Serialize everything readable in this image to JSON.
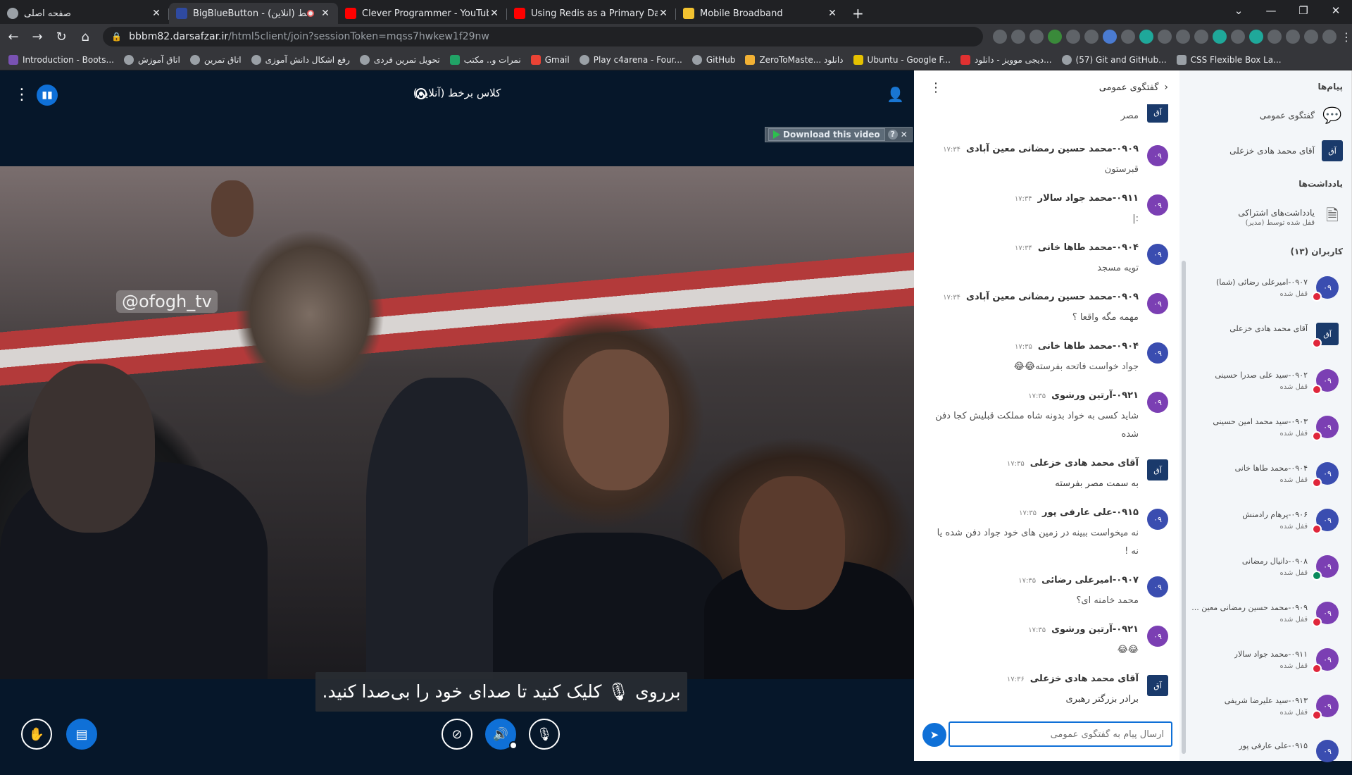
{
  "browser": {
    "tabs": [
      {
        "label": "صفحه اصلی",
        "active": false
      },
      {
        "label": "BigBlueButton - برخط (آنلاین)",
        "active": true
      },
      {
        "label": "Clever Programmer - YouTube",
        "active": false
      },
      {
        "label": "Using Redis as a Primary Databa",
        "active": false
      },
      {
        "label": "Mobile Broadband",
        "active": false
      }
    ],
    "url_host": "bbbm82.darsafzar.ir",
    "url_path": "/html5client/join?sessionToken=mqss7hwkew1f29nw",
    "bookmarks": [
      "Introduction - Boots...",
      "اتاق آموزش",
      "اتاق تمرین",
      "رفع اشکال دانش آموزی",
      "تحویل تمرین فردی",
      "نمرات و.. مکتب",
      "Gmail",
      "Play c4arena - Four...",
      "GitHub",
      "ZeroToMaste... دانلود",
      "Ubuntu - Google F...",
      "دیجی موویز - دانلود...",
      "(57) Git and GitHub...",
      "CSS Flexible Box La..."
    ]
  },
  "meeting": {
    "title": "کلاس برخط (آنلاین)",
    "download_label": "Download this video",
    "watermark": "@ofogh_tv",
    "mute_tip": "برروی 🎙 کلیک کنید تا صدای خود را بی‌صدا کنید."
  },
  "chat": {
    "header": "گفتگوی عمومی",
    "input_placeholder": "ارسال پیام به گفتگوی عمومی",
    "messages": [
      {
        "name": "",
        "time": "",
        "text": "مصر",
        "avatar": "آق"
      },
      {
        "name": "۰۹۰۹-محمد حسین رمضانی معین آبادی",
        "time": "۱۷:۳۴",
        "text": "قبرستون",
        "avatar": "۰۹"
      },
      {
        "name": "۰۹۱۱-محمد جواد سالار",
        "time": "۱۷:۳۴",
        "text": ":|",
        "avatar": "۰۹"
      },
      {
        "name": "۰۹۰۴-محمد طاها خانی",
        "time": "۱۷:۳۴",
        "text": "تویه مسجد",
        "avatar": "۰۹"
      },
      {
        "name": "۰۹۰۹-محمد حسین رمضانی معین آبادی",
        "time": "۱۷:۳۴",
        "text": "مهمه مگه واقعا ؟",
        "avatar": "۰۹"
      },
      {
        "name": "۰۹۰۴-محمد طاها خانی",
        "time": "۱۷:۳۵",
        "text": "جواد خواست فاتحه بفرسته😂😂",
        "avatar": "۰۹"
      },
      {
        "name": "۰۹۲۱-آرتین ورشوی",
        "time": "۱۷:۳۵",
        "text": "شاید کسی به خواد بدونه شاه مملکت قبلیش کجا دفن شده",
        "avatar": "۰۹"
      },
      {
        "name": "آقای محمد هادی خزعلی",
        "time": "۱۷:۳۵",
        "text": "به سمت مصر بفرسته",
        "avatar": "آق"
      },
      {
        "name": "۰۹۱۵-علی عارفی پور",
        "time": "۱۷:۳۵",
        "text": "نه میخواست ببینه در زمین های خود جواد دفن شده یا نه !",
        "avatar": "۰۹"
      },
      {
        "name": "۰۹۰۷-امیرعلی رضائی",
        "time": "۱۷:۳۵",
        "text": "محمد خامنه ای؟",
        "avatar": "۰۹"
      },
      {
        "name": "۰۹۲۱-آرتین ورشوی",
        "time": "۱۷:۳۵",
        "text": "😂😂",
        "avatar": "۰۹"
      },
      {
        "name": "آقای محمد هادی خزعلی",
        "time": "۱۷:۳۶",
        "text": "برادر بزرگتر رهبری",
        "avatar": "آق"
      }
    ]
  },
  "sidebar": {
    "messages_title": "پیام‌ها",
    "public_chat": "گفتگوی عمومی",
    "private_chat": "آقای محمد هادی خزعلی",
    "notes_title": "یادداشت‌ها",
    "shared_notes": "یادداشت‌های اشتراکی",
    "notes_locked": "قفل شده توسط (مدیر)",
    "users_title": "کاربران (۱۳)",
    "lock_label": "قفل شده",
    "users": [
      {
        "name": "۰۹۰۷-امیرعلی رضائی (شما)",
        "avatar": "۰۹",
        "mic": "muted"
      },
      {
        "name": "آقای محمد هادی خزعلی",
        "avatar": "آق",
        "mic": "muted"
      },
      {
        "name": "۰۹۰۲-سید علی صدرا حسینی",
        "avatar": "۰۹",
        "mic": "muted"
      },
      {
        "name": "۰۹۰۳-سید محمد امین حسینی",
        "avatar": "۰۹",
        "mic": "muted"
      },
      {
        "name": "۰۹۰۴-محمد طاها خانی",
        "avatar": "۰۹",
        "mic": "muted"
      },
      {
        "name": "۰۹۰۶-پرهام رادمنش",
        "avatar": "۰۹",
        "mic": "muted"
      },
      {
        "name": "۰۹۰۸-دانیال رمضانی",
        "avatar": "۰۹",
        "mic": "on"
      },
      {
        "name": "۰۹۰۹-محمد حسین رمضانی معین ...",
        "avatar": "۰۹",
        "mic": "muted"
      },
      {
        "name": "۰۹۱۱-محمد جواد سالار",
        "avatar": "۰۹",
        "mic": "muted"
      },
      {
        "name": "۰۹۱۳-سید علیرضا شریفی",
        "avatar": "۰۹",
        "mic": "muted"
      },
      {
        "name": "۰۹۱۵-علی عارفی پور",
        "avatar": "۰۹",
        "mic": "muted"
      }
    ]
  },
  "colors": {
    "accent": "#0f70d7",
    "avatar_purple": "#7b3fb3",
    "avatar_blue": "#3a4db0",
    "mic_muted": "#e0263b",
    "mic_on": "#0a8a5c"
  }
}
